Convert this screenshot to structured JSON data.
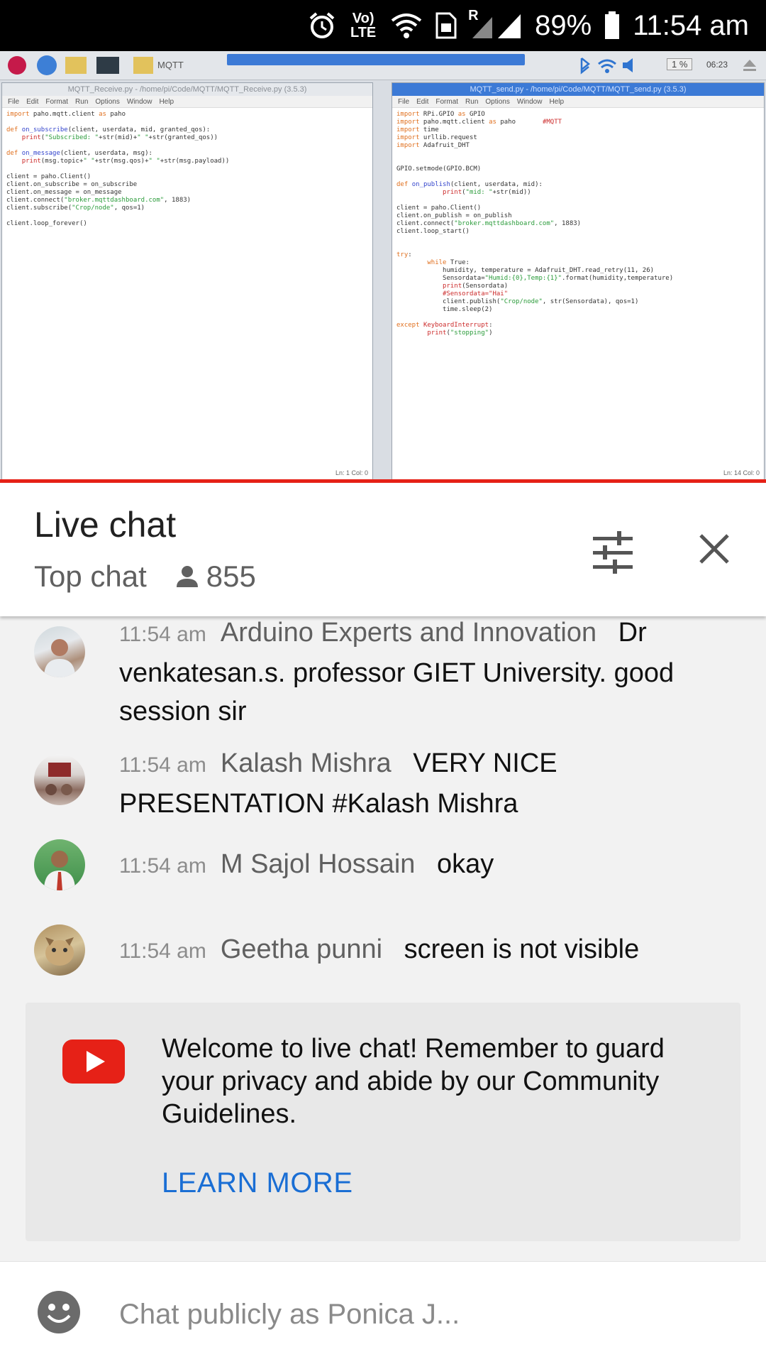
{
  "status_bar": {
    "network": "Vo) LTE",
    "signal_badge": "R",
    "battery_percent": "89%",
    "time": "11:54 am"
  },
  "video": {
    "taskbar_folder": "MQTT",
    "tray_time": "06:23",
    "tray_badge": "1 %",
    "left_window_title": "MQTT_Receive.py - /home/pi/Code/MQTT/MQTT_Receive.py (3.5.3)",
    "right_window_title": "MQTT_send.py - /home/pi/Code/MQTT/MQTT_send.py (3.5.3)",
    "menu": [
      "File",
      "Edit",
      "Format",
      "Run",
      "Options",
      "Window",
      "Help"
    ],
    "left_status": "Ln: 1  Col: 0",
    "right_status": "Ln: 14  Col: 0",
    "progress_percent": 100
  },
  "header": {
    "title": "Live chat",
    "mode": "Top chat",
    "viewer_count": "855",
    "filter_icon": "tune-icon",
    "close_icon": "close-icon"
  },
  "messages": [
    {
      "time": "11:54 am",
      "author": "Arduino Experts and Innovation",
      "text": "Dr venkatesan.s. professor GIET University. good session sir"
    },
    {
      "time": "11:54 am",
      "author": "Kalash Mishra",
      "text": "VERY NICE PRESENTATION #Kalash Mishra"
    },
    {
      "time": "11:54 am",
      "author": "M Sajol Hossain",
      "text": "okay"
    },
    {
      "time": "11:54 am",
      "author": "Geetha punni",
      "text": "screen is not visible"
    }
  ],
  "welcome": {
    "text": "Welcome to live chat! Remember to guard your privacy and abide by our Community Guidelines.",
    "link": "LEARN MORE"
  },
  "input": {
    "placeholder": "Chat publicly as Ponica J..."
  },
  "colors": {
    "accent_red": "#e62117",
    "link_blue": "#1a6ed4",
    "chat_bg": "#f2f2f2"
  }
}
